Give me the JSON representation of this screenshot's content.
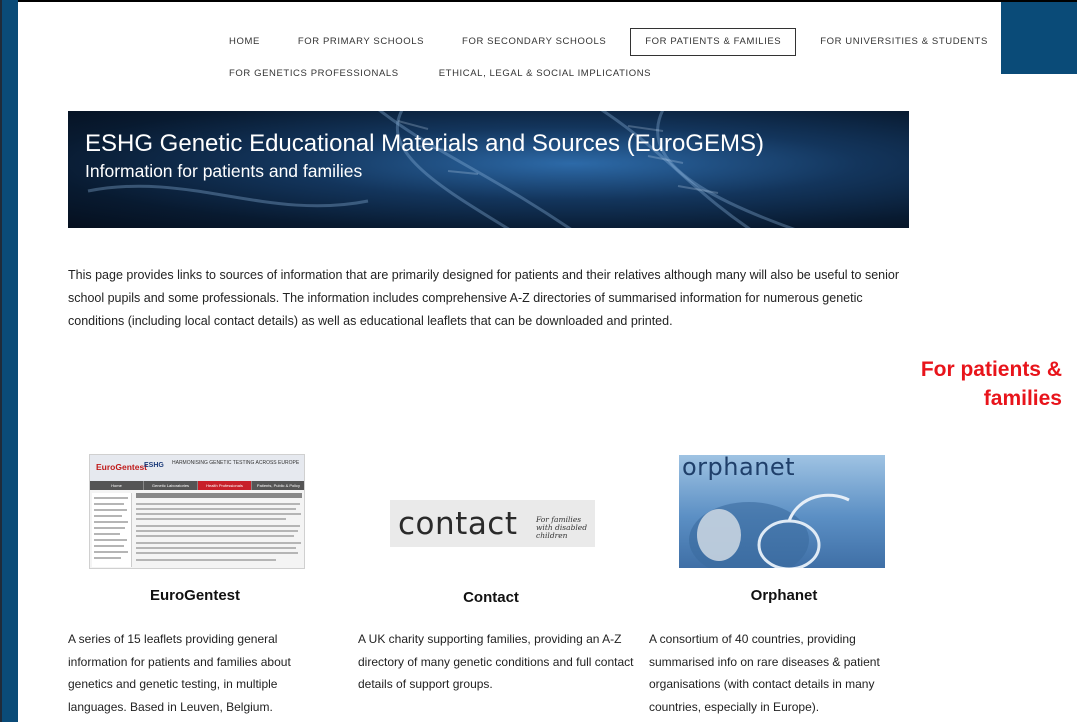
{
  "nav": {
    "row1": [
      "HOME",
      "FOR PRIMARY SCHOOLS",
      "FOR SECONDARY SCHOOLS",
      "FOR PATIENTS & FAMILIES",
      "FOR UNIVERSITIES & STUDENTS"
    ],
    "row2": [
      "FOR GENETICS PROFESSIONALS",
      "ETHICAL, LEGAL & SOCIAL IMPLICATIONS"
    ],
    "active": "FOR PATIENTS & FAMILIES"
  },
  "banner": {
    "title": "ESHG Genetic Educational Materials and Sources (EuroGEMS)",
    "subtitle": "Information for patients and families"
  },
  "intro": "This page provides links to sources of information that are primarily designed for patients and their relatives although many will also be useful to senior school pupils and some professionals. The information includes comprehensive A-Z directories of summarised information for numerous genetic conditions (including local contact details) as well as educational leaflets that can be downloaded and printed.",
  "side_note": "For patients & families",
  "cards": [
    {
      "title": "EuroGentest",
      "description": "A series of 15 leaflets providing general information for patients and families about genetics and genetic testing, in multiple languages. Based in Leuven, Belgium."
    },
    {
      "title": "Contact",
      "description": "A UK charity supporting families, providing an A-Z directory of many genetic conditions and full contact details of support groups."
    },
    {
      "title": "Orphanet",
      "description": "A consortium of 40 countries, providing summarised info on rare diseases & patient organisations (with contact details in many countries, especially in Europe)."
    }
  ],
  "thumbnails": {
    "eurogentest": {
      "logo_left": "EuroGentest",
      "logo_mid": "ESHG",
      "logo_right": "HARMONISING GENETIC TESTING ACROSS EUROPE",
      "tabs": [
        "Home",
        "Genetic Laboratories",
        "Health Professionals",
        "Patients, Public & Policy"
      ]
    },
    "contact": {
      "wordmark": "contact",
      "tagline_1": "For families",
      "tagline_2": "with disabled children"
    },
    "orphanet": {
      "wordmark": "orphanet"
    }
  },
  "colors": {
    "accent_blue": "#0a4b78",
    "side_note_red": "#e8141b"
  }
}
